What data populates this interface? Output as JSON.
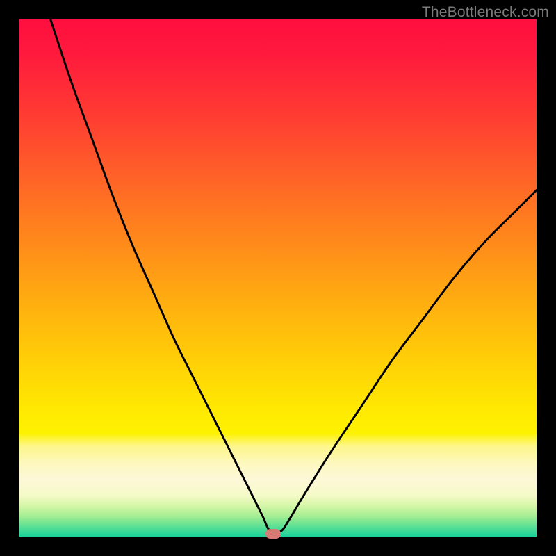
{
  "attribution": "TheBottleneck.com",
  "colors": {
    "frame": "#000000",
    "gradient_top": "#ff0e3f",
    "gradient_mid": "#ffe802",
    "gradient_bottom": "#1cd19c",
    "curve": "#000000",
    "marker": "#d77a73",
    "attribution_text": "#7a7a7a"
  },
  "chart_data": {
    "type": "line",
    "title": "",
    "xlabel": "",
    "ylabel": "",
    "xlim": [
      0,
      100
    ],
    "ylim": [
      0,
      100
    ],
    "annotations": [
      "TheBottleneck.com"
    ],
    "grid": false,
    "legend": false,
    "marker": {
      "x": 49,
      "y": 0.5
    },
    "series": [
      {
        "name": "curve",
        "x": [
          6,
          10,
          14,
          18,
          22,
          26,
          30,
          34,
          38,
          42,
          45,
          47,
          48.5,
          50.5,
          52,
          55,
          60,
          66,
          72,
          78,
          84,
          90,
          96,
          100
        ],
        "y": [
          100,
          88,
          77,
          66,
          56,
          47,
          38,
          30,
          22,
          14,
          8,
          4,
          1,
          1,
          3,
          8,
          16,
          25,
          34,
          42,
          50,
          57,
          63,
          67
        ]
      }
    ]
  }
}
